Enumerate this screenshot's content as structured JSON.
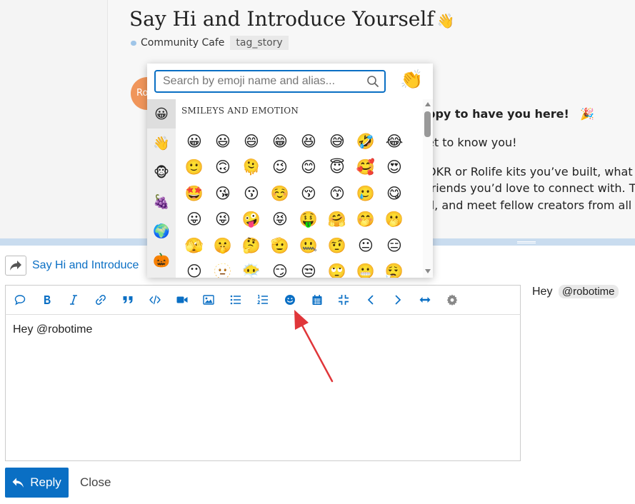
{
  "topic": {
    "title": "Say Hi and Introduce Yourself",
    "title_emoji": "👋",
    "category": "Community Cafe",
    "tag": "tag_story",
    "avatar_text": "Ro",
    "post_lines": [
      "ppy to have you here!",
      "et to know you!",
      "OKR or Rolife kits you’ve built, what ki",
      " friends you’d love to connect with. T",
      "d, and meet fellow creators from all"
    ],
    "party_emoji": "🎉"
  },
  "emoji_picker": {
    "search_placeholder": "Search by emoji name and alias...",
    "skin_tone_emoji": "👏",
    "categories": [
      {
        "name": "smileys",
        "emoji": "😀"
      },
      {
        "name": "people",
        "emoji": "👋"
      },
      {
        "name": "animals",
        "emoji": "🐵"
      },
      {
        "name": "food",
        "emoji": "🍇"
      },
      {
        "name": "travel",
        "emoji": "🌍"
      },
      {
        "name": "activities",
        "emoji": "🎃"
      }
    ],
    "section_title": "SMILEYS AND EMOTION",
    "emojis": [
      "😀",
      "😃",
      "😄",
      "😁",
      "😆",
      "😅",
      "🤣",
      "😂",
      "🙂",
      "🙃",
      "🫠",
      "😉",
      "😊",
      "😇",
      "🥰",
      "😍",
      "🤩",
      "😘",
      "😗",
      "☺️",
      "😚",
      "😙",
      "🥲",
      "😋",
      "😛",
      "😜",
      "🤪",
      "😝",
      "🤑",
      "🤗",
      "🤭",
      "🫢",
      "🫣",
      "🤫",
      "🤔",
      "🫡",
      "🤐",
      "🤨",
      "😐",
      "😑",
      "😶",
      "🫥",
      "😶‍🌫️",
      "😏",
      "😒",
      "🙄",
      "😬",
      "😮‍💨"
    ]
  },
  "composer": {
    "reply_to_title": "Say Hi and Introduce",
    "editor_text": "Hey @robotime",
    "preview_text": "Hey",
    "preview_mention": "@robotime",
    "toolbar_icons": [
      "quote-bubble-icon",
      "bold-icon",
      "italic-icon",
      "link-icon",
      "blockquote-icon",
      "code-icon",
      "video-icon",
      "image-icon",
      "bullet-list-icon",
      "numbered-list-icon",
      "emoji-icon",
      "calendar-icon",
      "collapse-icon",
      "chevron-left-icon",
      "chevron-right-icon",
      "arrows-horizontal-icon",
      "gear-icon"
    ],
    "reply_label": "Reply",
    "close_label": "Close",
    "accent_color": "#0a6fc4",
    "arrow_color": "#e0363a"
  }
}
